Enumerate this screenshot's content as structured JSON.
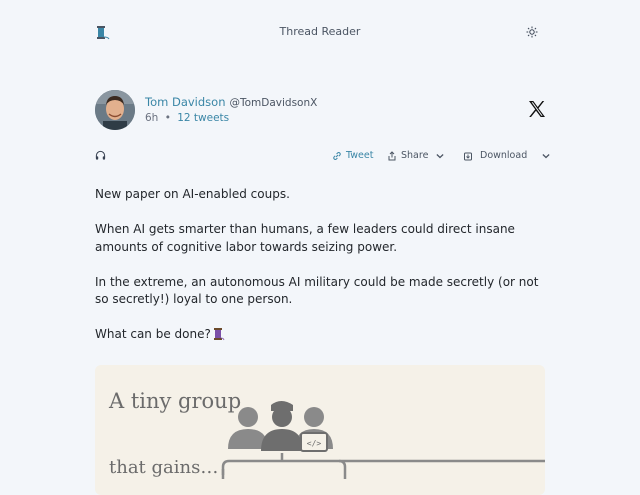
{
  "app": {
    "title": "Thread Reader"
  },
  "author": {
    "name": "Tom Davidson",
    "handle": "@TomDavidsonX",
    "time_ago": "6h",
    "separator": "•",
    "tweet_count": "12 tweets"
  },
  "actions": {
    "tweet": "Tweet",
    "share": "Share",
    "download": "Download"
  },
  "content": {
    "paragraphs": [
      "New paper on AI-enabled coups.",
      "When AI gets smarter than humans, a few leaders could direct insane amounts of cognitive labor towards seizing power.",
      "In the extreme, an autonomous AI military could be made secretly (or not so secretly!) loyal to one person.",
      "What can be done?"
    ]
  },
  "card": {
    "line1": "A tiny group",
    "line2": "that gains…"
  },
  "colors": {
    "accent": "#3a86a6",
    "background": "#f3f6fa",
    "card_bg": "#f5f1e8"
  },
  "icons": [
    "spool-logo-icon",
    "sun-icon",
    "x-logo-icon",
    "headphones-icon",
    "link-icon",
    "share-icon",
    "download-icon",
    "chevron-down-icon",
    "spool-emoji-icon"
  ]
}
